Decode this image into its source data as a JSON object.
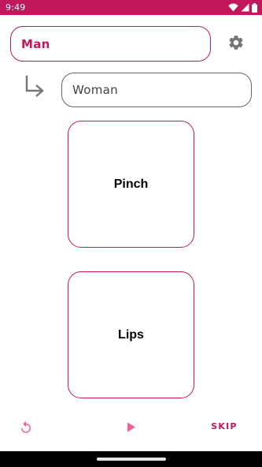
{
  "status_bar": {
    "time": "9:49",
    "background": "#c2185b",
    "icons": [
      "wifi-icon",
      "signal-icon",
      "battery-icon"
    ]
  },
  "source_field": {
    "value": "Man",
    "color": "#c2185b"
  },
  "target_field": {
    "value": "Woman"
  },
  "cards": [
    {
      "label": "Pinch"
    },
    {
      "label": "Lips"
    }
  ],
  "controls": {
    "reset_icon": "reset-icon",
    "play_icon": "play-icon",
    "skip_label": "SKIP"
  },
  "icons": {
    "settings": "gear-icon",
    "arrow": "arrow-down-right-icon"
  },
  "colors": {
    "accent": "#c2185b",
    "accent_light": "#f06292",
    "muted": "#757575"
  }
}
